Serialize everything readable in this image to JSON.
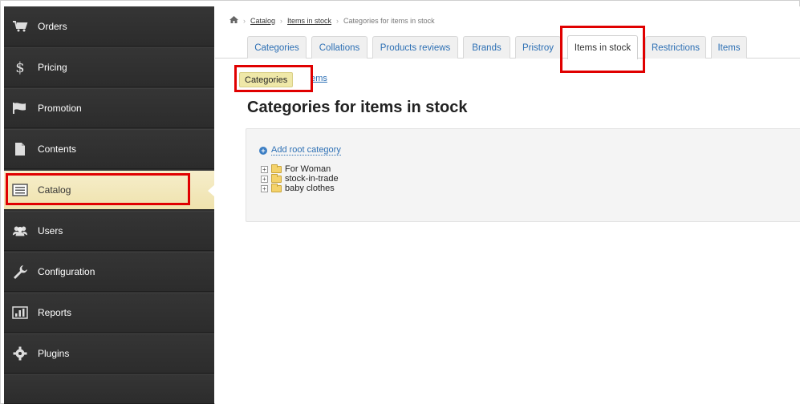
{
  "sidebar": {
    "items": [
      {
        "label": "Orders",
        "icon": "cart-icon"
      },
      {
        "label": "Pricing",
        "icon": "dollar-icon"
      },
      {
        "label": "Promotion",
        "icon": "flag-icon"
      },
      {
        "label": "Contents",
        "icon": "document-icon"
      },
      {
        "label": "Catalog",
        "icon": "list-icon",
        "active": true
      },
      {
        "label": "Users",
        "icon": "users-icon"
      },
      {
        "label": "Configuration",
        "icon": "wrench-icon"
      },
      {
        "label": "Reports",
        "icon": "bar-chart-icon"
      },
      {
        "label": "Plugins",
        "icon": "gear-icon"
      }
    ]
  },
  "breadcrumb": {
    "home_icon": "home-icon",
    "items": [
      "Catalog",
      "Items in stock",
      "Categories for items in stock"
    ]
  },
  "tabs": [
    {
      "label": "Categories"
    },
    {
      "label": "Collations"
    },
    {
      "label": "Products reviews"
    },
    {
      "label": "Brands"
    },
    {
      "label": "Pristroy"
    },
    {
      "label": "Items in stock",
      "active": true
    },
    {
      "label": "Restrictions"
    },
    {
      "label": "Items"
    }
  ],
  "subtabs": {
    "active": "Categories",
    "other": "Items"
  },
  "page": {
    "title": "Categories for items in stock"
  },
  "tree": {
    "add_root_label": "Add root category",
    "nodes": [
      "For Woman",
      "stock-in-trade",
      "baby clothes"
    ]
  },
  "colors": {
    "sidebar_bg": "#2f2f2f",
    "active_item_bg": "#f2e8bb",
    "highlight": "#e00000",
    "link": "#2c6fb4"
  }
}
